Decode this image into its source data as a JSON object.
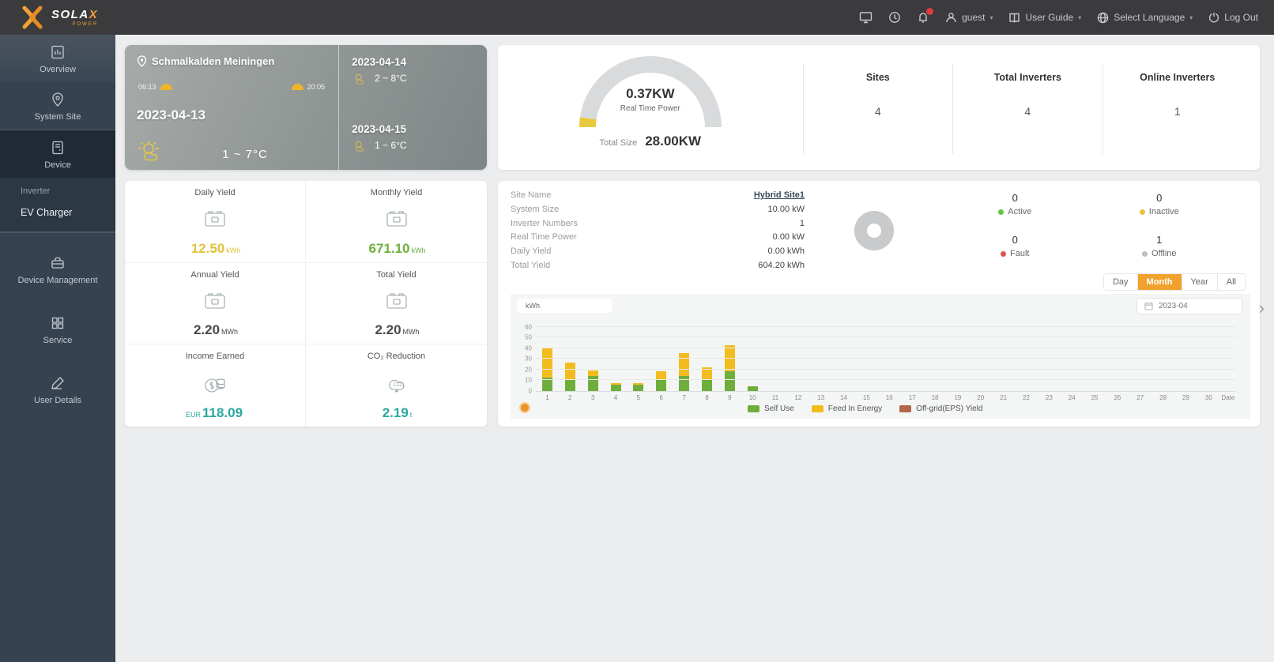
{
  "topbar": {
    "brand": "SOLA",
    "brand_x": "X",
    "brand_sub": "POWER",
    "user": "guest",
    "user_guide": "User Guide",
    "language": "Select Language",
    "logout": "Log Out"
  },
  "icons": {
    "brand": "orange-x-mark",
    "topbar_buttons": [
      "monitor-icon",
      "alarm-icon",
      "bell-icon"
    ],
    "notification_badge_color": "#e4393c",
    "user": "person-icon",
    "guide": "book-icon",
    "language": "globe-icon",
    "logout": "power-icon",
    "location": "pin-icon",
    "calendar": "calendar-icon",
    "carousel": "orange-dot",
    "next": "chevron-right"
  },
  "sidebar": {
    "items": [
      {
        "label": "Overview"
      },
      {
        "label": "System Site"
      },
      {
        "label": "Device"
      },
      {
        "label": "Device Management"
      },
      {
        "label": "Service"
      },
      {
        "label": "User Details"
      }
    ],
    "device_submenu": [
      {
        "label": "Inverter"
      },
      {
        "label": "EV Charger"
      }
    ]
  },
  "weather": {
    "location": "Schmalkalden Meiningen",
    "sunrise": "06:13",
    "sunset": "20:05",
    "today_date": "2023-04-13",
    "today_temp": "1 ~ 7°C",
    "forecast": [
      {
        "date": "2023-04-14",
        "temp": "2 ~ 8°C"
      },
      {
        "date": "2023-04-15",
        "temp": "1 ~ 6°C"
      }
    ]
  },
  "power_overview": {
    "realtime_value": "0.37KW",
    "realtime_label": "Real Time Power",
    "total_size_label": "Total Size",
    "total_size_value": "28.00KW",
    "gauge_color": "#e8c93c",
    "stats": [
      {
        "label": "Sites",
        "value": "4"
      },
      {
        "label": "Total Inverters",
        "value": "4"
      },
      {
        "label": "Online Inverters",
        "value": "1"
      }
    ]
  },
  "yield_tiles": [
    {
      "label": "Daily Yield",
      "prefix": "",
      "value": "12.50",
      "unit": "kWh",
      "color": "#e4c23c",
      "icon": "yield-meter-icon"
    },
    {
      "label": "Monthly Yield",
      "prefix": "",
      "value": "671.10",
      "unit": "kWh",
      "color": "#6fae3d",
      "icon": "yield-meter-icon"
    },
    {
      "label": "Annual Yield",
      "prefix": "",
      "value": "2.20",
      "unit": "MWh",
      "color": "#4a4a4a",
      "icon": "yield-meter-icon"
    },
    {
      "label": "Total Yield",
      "prefix": "",
      "value": "2.20",
      "unit": "MWh",
      "color": "#4a4a4a",
      "icon": "yield-meter-icon"
    },
    {
      "label": "Income Earned",
      "prefix": "EUR",
      "value": "118.09",
      "unit": "",
      "color": "#2aa79f",
      "icon": "coins-icon"
    },
    {
      "label": "CO₂ Reduction",
      "prefix": "",
      "value": "2.19",
      "unit": "t",
      "color": "#2aa79f",
      "icon": "co2-cloud-icon"
    }
  ],
  "site_panel": {
    "details": [
      {
        "label": "Site Name",
        "value": "Hybrid Site1",
        "link": true
      },
      {
        "label": "System Size",
        "value": "10.00 kW"
      },
      {
        "label": "Inverter Numbers",
        "value": "1"
      },
      {
        "label": "Real Time Power",
        "value": "0.00 kW"
      },
      {
        "label": "Daily Yield",
        "value": "0.00 kWh"
      },
      {
        "label": "Total Yield",
        "value": "604.20 kWh"
      }
    ],
    "status": [
      {
        "label": "Active",
        "value": "0",
        "color": "#67c23a"
      },
      {
        "label": "Inactive",
        "value": "0",
        "color": "#e6c339"
      },
      {
        "label": "Fault",
        "value": "0",
        "color": "#d9534f"
      },
      {
        "label": "Offline",
        "value": "1",
        "color": "#bfbfbf"
      }
    ],
    "range_buttons": [
      {
        "label": "Day",
        "active": false
      },
      {
        "label": "Month",
        "active": true
      },
      {
        "label": "Year",
        "active": false
      },
      {
        "label": "All",
        "active": false
      }
    ],
    "active_range_color": "#f0a22d",
    "date_value": "2023-04"
  },
  "chart_data": {
    "type": "bar",
    "stacked": true,
    "title": "",
    "unit": "kWh",
    "xlabel_end": "Date",
    "ylim": [
      0,
      60
    ],
    "yticks": [
      0,
      10,
      20,
      30,
      40,
      50,
      60
    ],
    "grid": true,
    "legend_position": "bottom",
    "categories": [
      "1",
      "2",
      "3",
      "4",
      "5",
      "6",
      "7",
      "8",
      "9",
      "10",
      "11",
      "12",
      "13",
      "14",
      "15",
      "16",
      "17",
      "18",
      "19",
      "20",
      "21",
      "22",
      "23",
      "24",
      "25",
      "26",
      "27",
      "28",
      "29",
      "30"
    ],
    "series": [
      {
        "name": "Self Use",
        "color": "#6fae3d",
        "values": [
          12,
          11,
          14,
          6,
          6,
          11,
          14,
          10,
          18,
          4,
          0,
          0,
          0,
          0,
          0,
          0,
          0,
          0,
          0,
          0,
          0,
          0,
          0,
          0,
          0,
          0,
          0,
          0,
          0,
          0
        ]
      },
      {
        "name": "Feed In Energy",
        "color": "#f2bc1f",
        "values": [
          28,
          15,
          5,
          1,
          1,
          7,
          21,
          12,
          24,
          0,
          0,
          0,
          0,
          0,
          0,
          0,
          0,
          0,
          0,
          0,
          0,
          0,
          0,
          0,
          0,
          0,
          0,
          0,
          0,
          0
        ]
      },
      {
        "name": "Off-grid(EPS) Yield",
        "color": "#b0674a",
        "values": [
          0,
          0,
          0,
          0,
          0,
          0,
          0,
          0,
          0,
          0,
          0,
          0,
          0,
          0,
          0,
          0,
          0,
          0,
          0,
          0,
          0,
          0,
          0,
          0,
          0,
          0,
          0,
          0,
          0,
          0
        ]
      }
    ]
  }
}
